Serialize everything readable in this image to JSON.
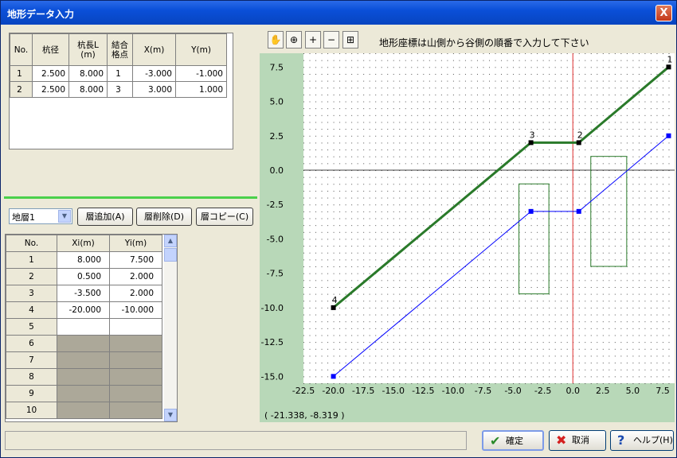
{
  "window": {
    "title": "地形データ入力",
    "close_label": "X"
  },
  "pile_table": {
    "headers": [
      "No.",
      "杭径",
      "杭長L\n(m)",
      "結合\n格点",
      "X(m)",
      "Y(m)"
    ],
    "rows": [
      [
        "1",
        "2.500",
        "8.000",
        "1",
        "-3.000",
        "-1.000"
      ],
      [
        "2",
        "2.500",
        "8.000",
        "3",
        "3.000",
        "1.000"
      ]
    ]
  },
  "layer_controls": {
    "combo_value": "地層1",
    "add_layer": "層追加(A)",
    "delete_layer": "層削除(D)",
    "copy_layer": "層コピー(C)"
  },
  "coord_table": {
    "headers": [
      "No.",
      "Xi(m)",
      "Yi(m)"
    ],
    "rows": [
      [
        "1",
        "8.000",
        "7.500"
      ],
      [
        "2",
        "0.500",
        "2.000"
      ],
      [
        "3",
        "-3.500",
        "2.000"
      ],
      [
        "4",
        "-20.000",
        "-10.000"
      ],
      [
        "5",
        "",
        ""
      ],
      [
        "6",
        "",
        ""
      ],
      [
        "7",
        "",
        ""
      ],
      [
        "8",
        "",
        ""
      ],
      [
        "9",
        "",
        ""
      ],
      [
        "10",
        "",
        ""
      ]
    ]
  },
  "toolbar": {
    "hint": "地形座標は山側から谷側の順番で入力して下さい",
    "icons": [
      "hand-icon",
      "zoom-area-icon",
      "zoom-in-icon",
      "zoom-out-icon",
      "fit-icon"
    ]
  },
  "chart_data": {
    "type": "line",
    "xlim": [
      -22.5,
      8.5
    ],
    "ylim": [
      -15.5,
      8.5
    ],
    "xticks": [
      -22.5,
      -20.0,
      -17.5,
      -15.0,
      -12.5,
      -10.0,
      -7.5,
      -5.0,
      -2.5,
      0.0,
      2.5,
      5.0,
      7.5
    ],
    "yticks": [
      7.5,
      5.0,
      2.5,
      0.0,
      -2.5,
      -5.0,
      -7.5,
      -10.0,
      -12.5,
      -15.0
    ],
    "grid": true,
    "series": [
      {
        "color": "#2a7a2a",
        "x": [
          8.0,
          0.5,
          -3.5,
          -20.0
        ],
        "y": [
          7.5,
          2.0,
          2.0,
          -10.0
        ],
        "point_labels": [
          "1",
          "2",
          "3",
          "4"
        ]
      },
      {
        "color": "#0000ff",
        "x": [
          8.0,
          0.5,
          -3.5,
          -20.0
        ],
        "y": [
          2.5,
          -3.0,
          -3.0,
          -15.0
        ]
      }
    ],
    "piles": [
      {
        "x0": -4.5,
        "x1": -2.0,
        "y0": -1.0,
        "y1": -9.0
      },
      {
        "x0": 1.5,
        "x1": 4.5,
        "y0": 1.0,
        "y1": -7.0
      }
    ],
    "red_vline_x": 0.0,
    "coord_readout": "( -21.338,   -8.319 )"
  },
  "footer": {
    "ok": "確定",
    "cancel": "取消",
    "help": "ヘルプ(H)"
  }
}
